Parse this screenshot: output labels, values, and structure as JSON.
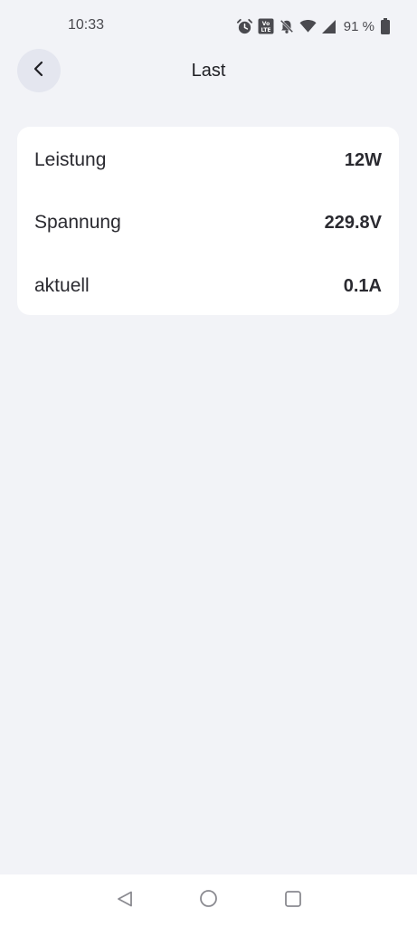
{
  "status_bar": {
    "time": "10:33",
    "battery_percent": "91 %",
    "icons": [
      "alarm-icon",
      "volte-icon",
      "mute-icon",
      "wifi-icon",
      "signal-icon",
      "battery-icon"
    ]
  },
  "header": {
    "title": "Last",
    "back_icon": "chevron-left-icon"
  },
  "readings": [
    {
      "label": "Leistung",
      "value": "12W"
    },
    {
      "label": "Spannung",
      "value": "229.8V"
    },
    {
      "label": "aktuell",
      "value": "0.1A"
    }
  ],
  "nav_bar": {
    "buttons": [
      "back-triangle-icon",
      "home-circle-icon",
      "recents-square-icon"
    ]
  },
  "colors": {
    "background": "#f2f3f7",
    "card": "#ffffff",
    "back_button_bg": "#e4e6ef",
    "text": "#2a2a30"
  }
}
